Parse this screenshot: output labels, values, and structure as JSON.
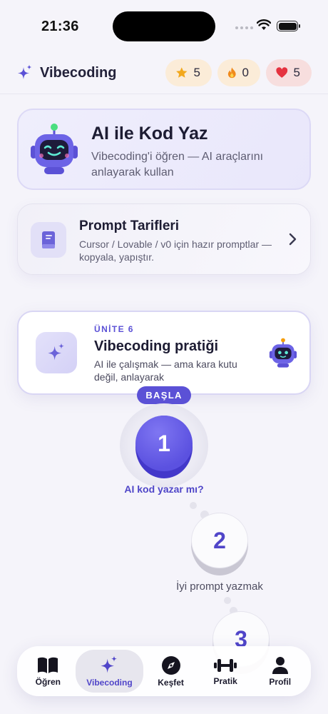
{
  "status_bar": {
    "time": "21:36"
  },
  "header": {
    "app_title": "Vibecoding",
    "stats": {
      "stars": "5",
      "streak": "0",
      "hearts": "5"
    }
  },
  "hero_card": {
    "title": "AI ile Kod Yaz",
    "subtitle": "Vibecoding'i öğren — AI araçlarını anlayarak kullan"
  },
  "prompt_card": {
    "title": "Prompt Tarifleri",
    "subtitle": "Cursor / Lovable / v0 için hazır promptlar — kopyala, yapıştır."
  },
  "unit_card": {
    "label": "ÜNİTE 6",
    "title": "Vibecoding pratiği",
    "subtitle": "AI ile çalışmak — ama kara kutu değil, anlayarak"
  },
  "path": {
    "start_label": "BAŞLA",
    "lessons": [
      {
        "number": "1",
        "title": "AI kod yazar mı?",
        "state": "current"
      },
      {
        "number": "2",
        "title": "İyi prompt yazmak",
        "state": "locked"
      },
      {
        "number": "3",
        "title": "",
        "state": "locked"
      }
    ]
  },
  "tab_bar": {
    "tabs": [
      {
        "label": "Öğren",
        "icon": "book-icon"
      },
      {
        "label": "Vibecoding",
        "icon": "sparkles-icon",
        "active": true
      },
      {
        "label": "Keşfet",
        "icon": "compass-icon"
      },
      {
        "label": "Pratik",
        "icon": "dumbbell-icon"
      },
      {
        "label": "Profil",
        "icon": "person-icon"
      }
    ]
  },
  "colors": {
    "accent": "#5b51d6",
    "background": "#f5f4fa",
    "star": "#f2a81d",
    "fire": "#f08a1c",
    "heart": "#e5323f"
  }
}
